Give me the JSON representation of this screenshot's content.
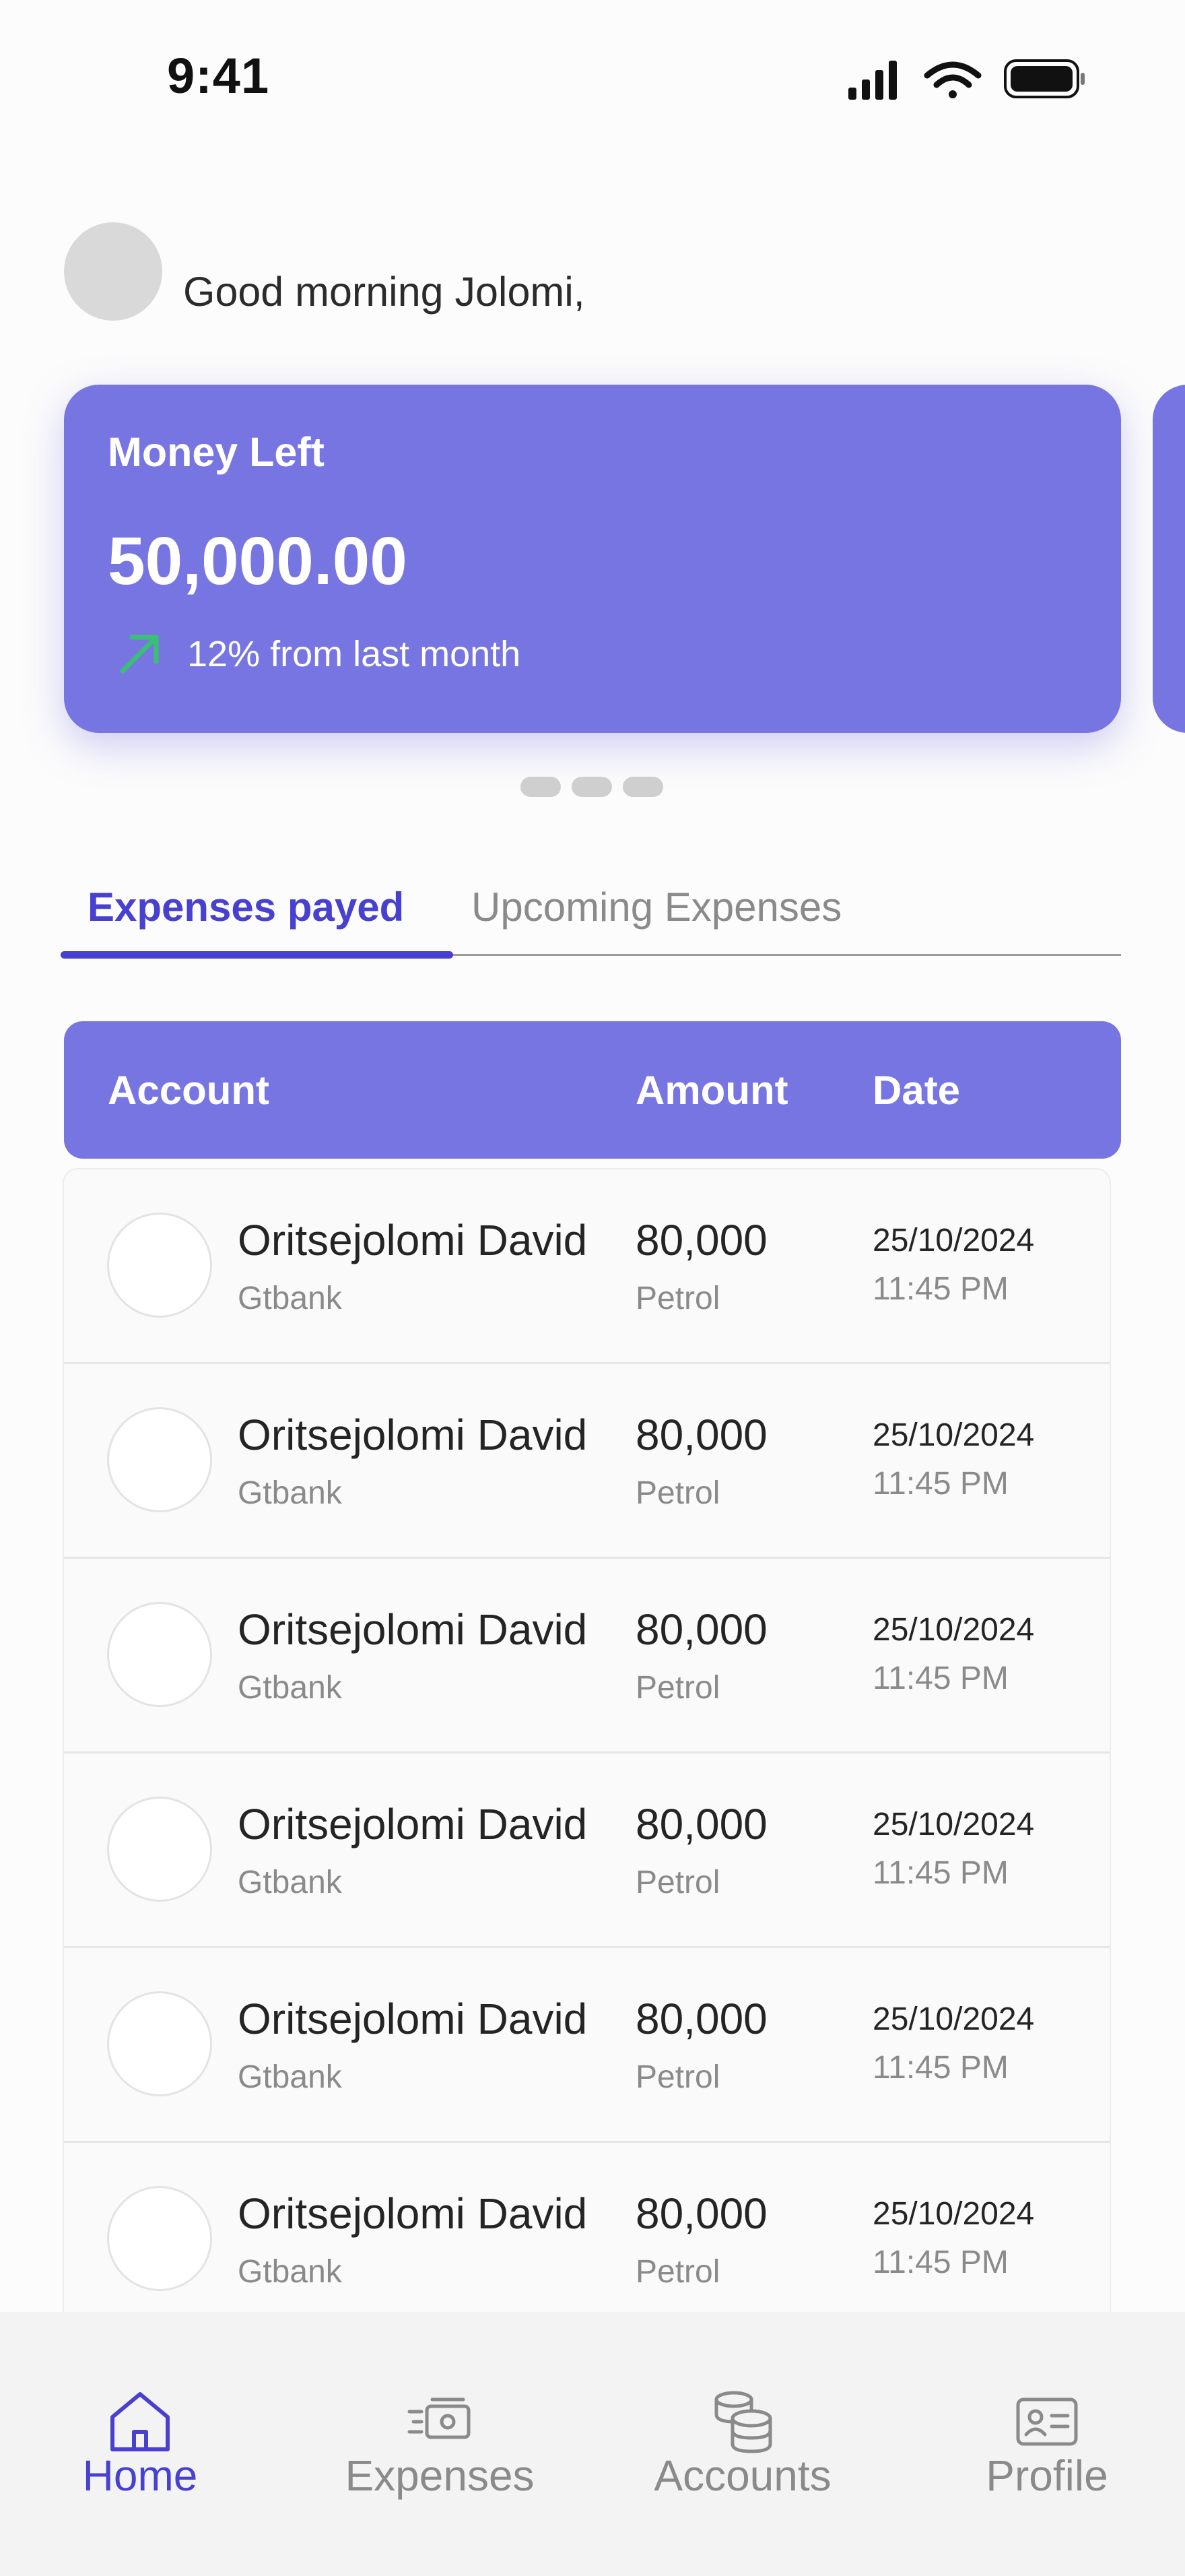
{
  "status_bar": {
    "time": "9:41"
  },
  "header": {
    "greeting": "Good morning Jolomi,"
  },
  "money_card": {
    "title": "Money Left",
    "amount": "50,000.00",
    "trend_text": "12% from last month",
    "trend_icon": "arrow-up-right-icon",
    "trend_color": "#38c172",
    "card_color": "#7775e2"
  },
  "carousel": {
    "pages": 3
  },
  "tabs": {
    "active": "Expenses payed",
    "inactive": "Upcoming Expenses",
    "accent_color": "#4740d0"
  },
  "table": {
    "headers": {
      "account": "Account",
      "amount": "Amount",
      "date": "Date"
    },
    "rows": [
      {
        "name": "Oritsejolomi David",
        "bank": "Gtbank",
        "amount": "80,000",
        "category": "Petrol",
        "date": "25/10/2024",
        "time": "11:45 PM"
      },
      {
        "name": "Oritsejolomi David",
        "bank": "Gtbank",
        "amount": "80,000",
        "category": "Petrol",
        "date": "25/10/2024",
        "time": "11:45 PM"
      },
      {
        "name": "Oritsejolomi David",
        "bank": "Gtbank",
        "amount": "80,000",
        "category": "Petrol",
        "date": "25/10/2024",
        "time": "11:45 PM"
      },
      {
        "name": "Oritsejolomi David",
        "bank": "Gtbank",
        "amount": "80,000",
        "category": "Petrol",
        "date": "25/10/2024",
        "time": "11:45 PM"
      },
      {
        "name": "Oritsejolomi David",
        "bank": "Gtbank",
        "amount": "80,000",
        "category": "Petrol",
        "date": "25/10/2024",
        "time": "11:45 PM"
      },
      {
        "name": "Oritsejolomi David",
        "bank": "Gtbank",
        "amount": "80,000",
        "category": "Petrol",
        "date": "25/10/2024",
        "time": "11:45 PM"
      }
    ]
  },
  "bottom_nav": {
    "items": [
      {
        "label": "Home",
        "icon": "home-icon",
        "active": true
      },
      {
        "label": "Expenses",
        "icon": "cash-icon",
        "active": false
      },
      {
        "label": "Accounts",
        "icon": "database-icon",
        "active": false
      },
      {
        "label": "Profile",
        "icon": "id-card-icon",
        "active": false
      }
    ]
  }
}
